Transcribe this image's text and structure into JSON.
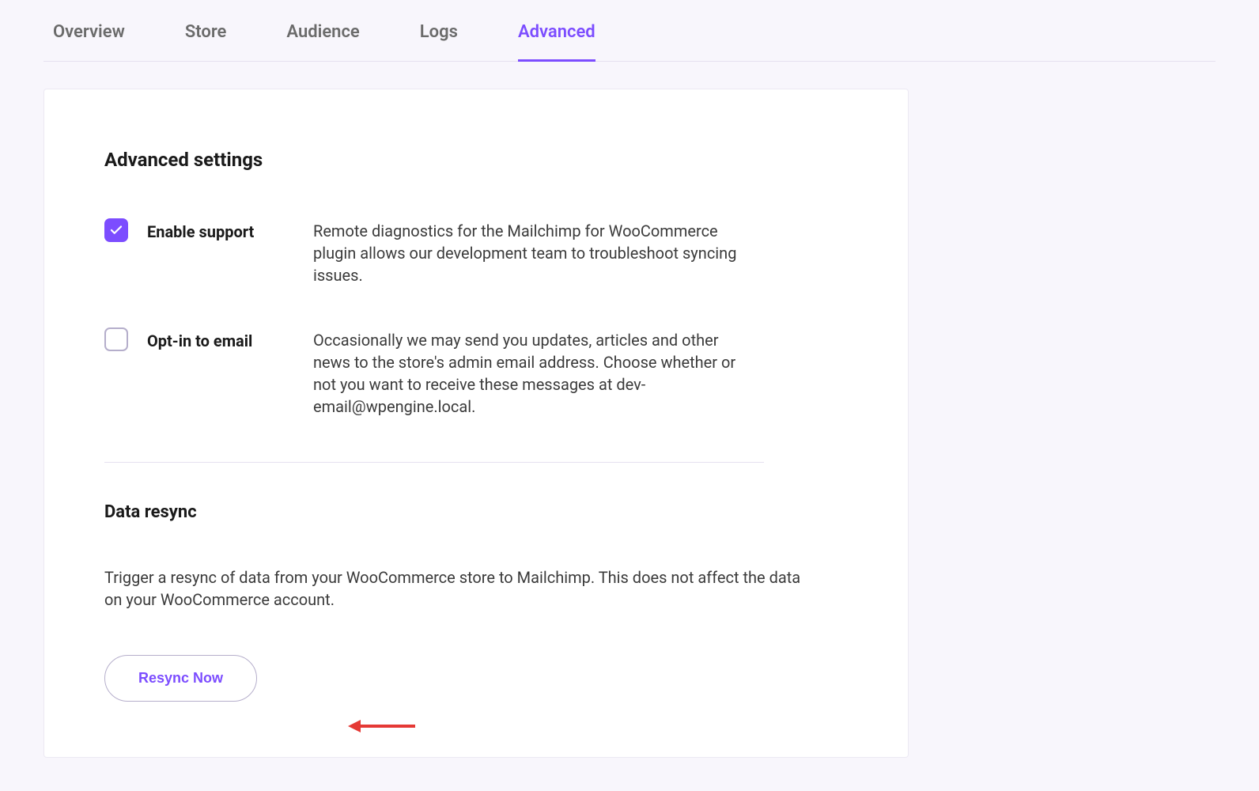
{
  "tabs": [
    {
      "label": "Overview",
      "active": false
    },
    {
      "label": "Store",
      "active": false
    },
    {
      "label": "Audience",
      "active": false
    },
    {
      "label": "Logs",
      "active": false
    },
    {
      "label": "Advanced",
      "active": true
    }
  ],
  "advanced": {
    "title": "Advanced settings",
    "settings": [
      {
        "label": "Enable support",
        "checked": true,
        "description": "Remote diagnostics for the Mailchimp for WooCommerce plugin allows our development team to troubleshoot syncing issues."
      },
      {
        "label": "Opt-in to email",
        "checked": false,
        "description": "Occasionally we may send you updates, articles and other news to the store's admin email address. Choose whether or not you want to receive these messages at dev-email@wpengine.local."
      }
    ]
  },
  "resync": {
    "title": "Data resync",
    "description": "Trigger a resync of data from your WooCommerce store to Mailchimp. This does not affect the data on your WooCommerce account.",
    "button_label": "Resync Now"
  },
  "annotation": {
    "arrow_color": "#e53935"
  }
}
